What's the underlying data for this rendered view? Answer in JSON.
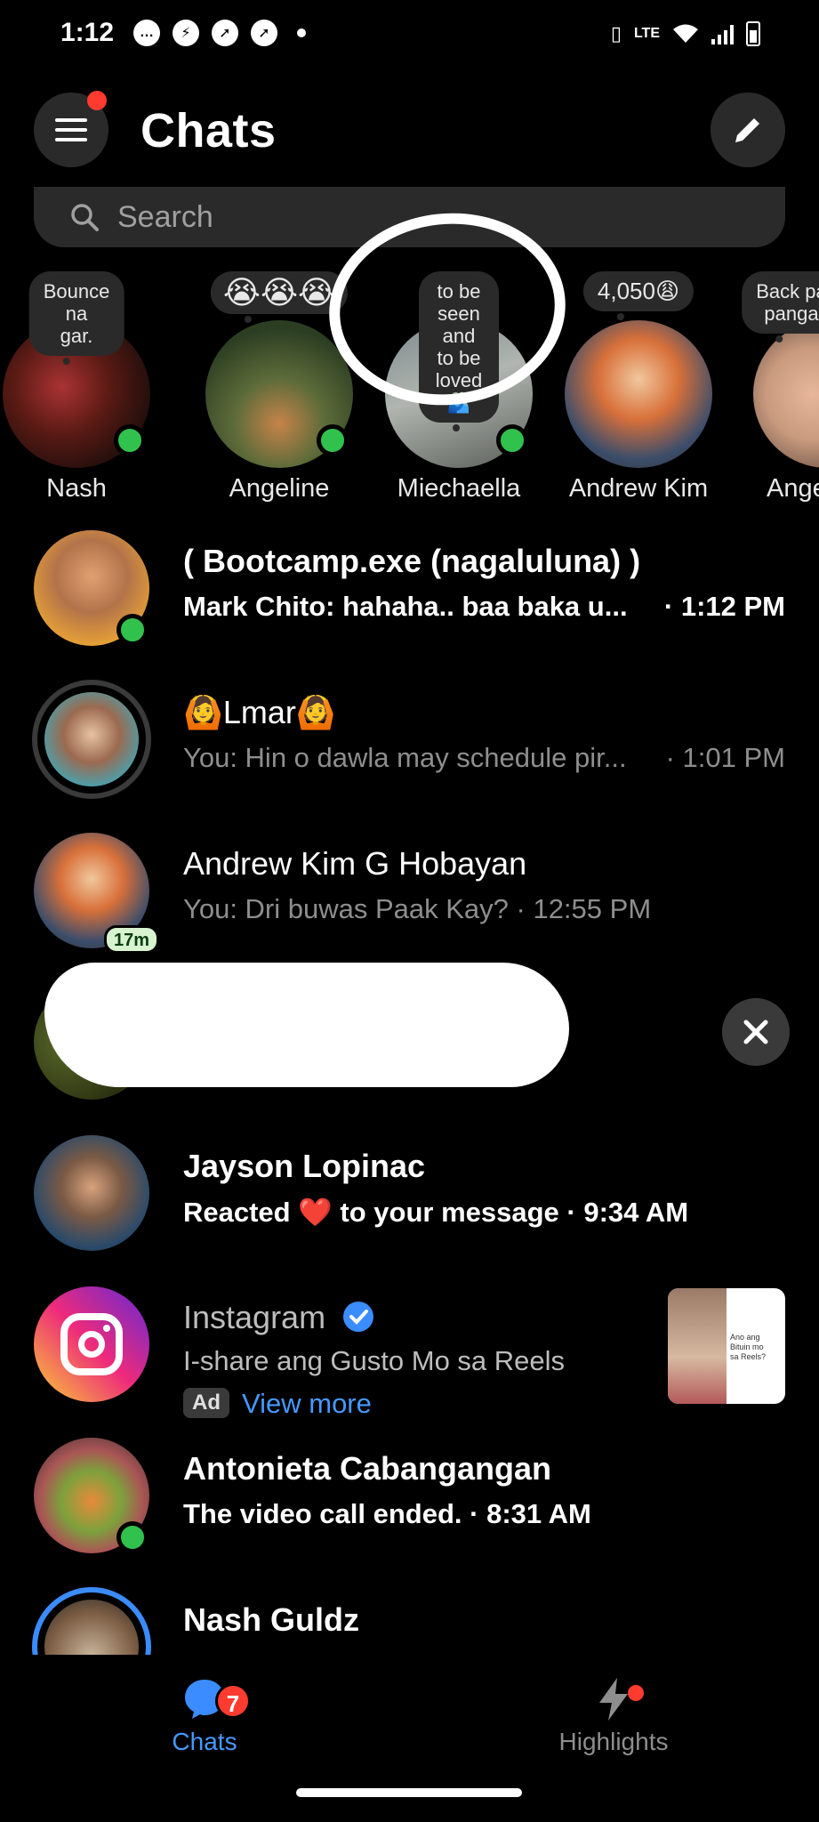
{
  "status_bar": {
    "time": "1:12"
  },
  "header": {
    "title": "Chats"
  },
  "search": {
    "placeholder": "Search"
  },
  "stories": [
    {
      "bubble": "Bounce na\ngar.",
      "name": "Nash",
      "online": true
    },
    {
      "bubble": "😭😭😭",
      "name": "Angeline",
      "online": true
    },
    {
      "bubble": "to be seen\nand to be\nloved🫂",
      "name": "Miechaella",
      "online": true
    },
    {
      "bubble": "4,050😩",
      "name": "Andrew Kim",
      "online": false
    },
    {
      "bubble": "Back pa\npanga",
      "name": "Ange",
      "online": false
    }
  ],
  "chats": [
    {
      "name": "( Bootcamp.exe (nagaluluna) )",
      "preview": "Mark Chito: hahaha.. baa baka u...",
      "time": "· 1:12 PM",
      "unread": true
    },
    {
      "name": "🙆Lmar🙆",
      "preview": "You: Hin o dawla may schedule pir...",
      "time": "· 1:01 PM",
      "unread": false
    },
    {
      "name": "Andrew Kim G Hobayan",
      "preview": "You: Dri buwas Paak Kay? · 12:55 PM",
      "time": "",
      "unread": false,
      "active_badge": "17m"
    },
    {
      "name": "Jayson Lopinac",
      "preview": "Reacted ❤️ to your message · 9:34 AM",
      "time": "",
      "unread": true
    },
    {
      "name": "Instagram",
      "preview": "I-share ang Gusto Mo sa Reels",
      "ad_tag": "Ad",
      "link": "View more",
      "ad_thumb_text": "Ano ang\nBituin mo\nsa Reels?"
    },
    {
      "name": "Antonieta Cabangangan",
      "preview": "The video call ended. · 8:31 AM",
      "time": "",
      "unread": true
    },
    {
      "name": "Nash Guldz",
      "preview": "",
      "time": "",
      "unread": true
    }
  ],
  "bottom_nav": {
    "chats_label": "Chats",
    "chats_badge": "7",
    "highlights_label": "Highlights"
  },
  "colors": {
    "background": "#000000",
    "surface": "#2a2a2a",
    "online": "#31c24e",
    "badge": "#ff3b30",
    "accent": "#4599ff"
  },
  "icons": [
    "menu-icon",
    "compose-icon",
    "search-icon",
    "close-icon",
    "verified-icon",
    "chat-bubble-icon",
    "lightning-icon"
  ]
}
